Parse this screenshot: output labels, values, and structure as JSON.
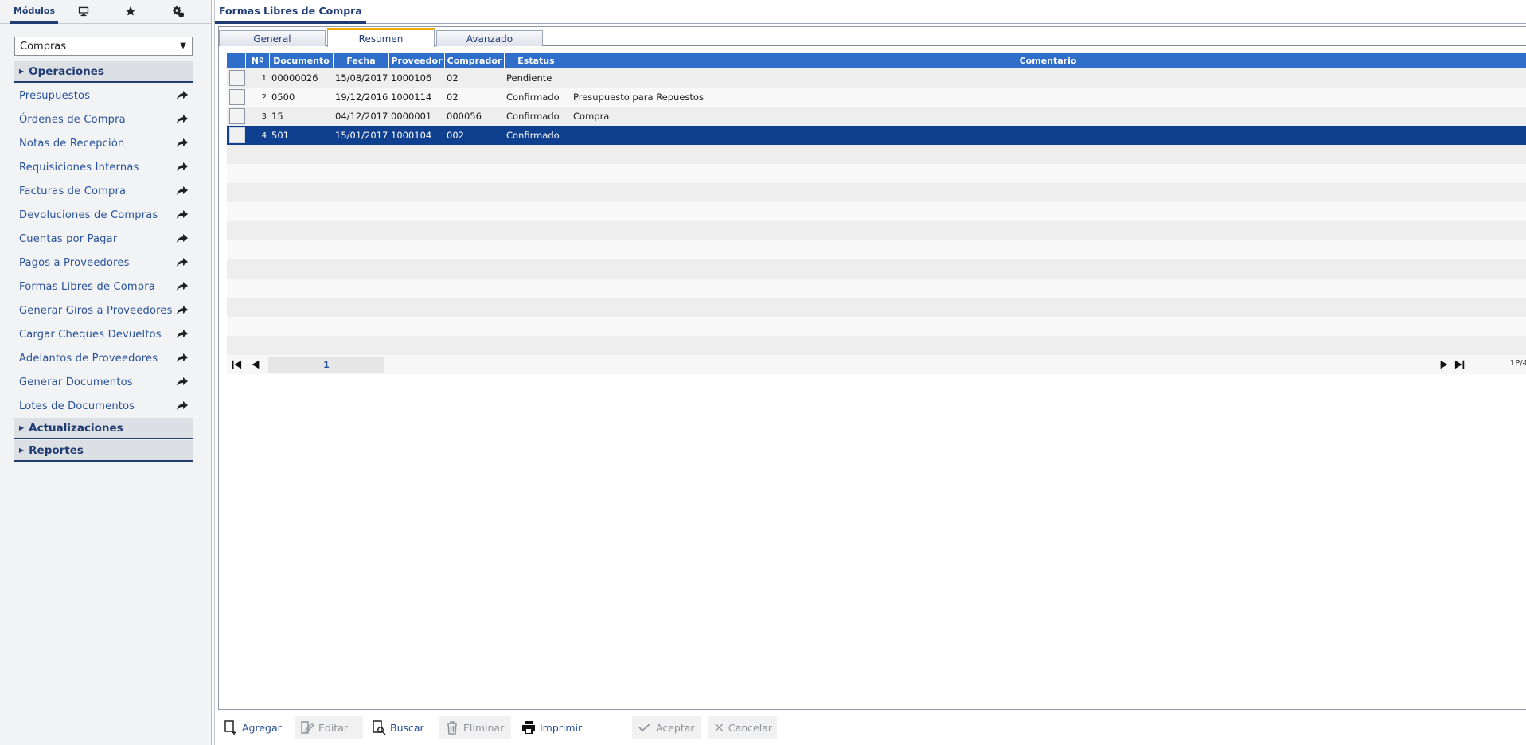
{
  "sidebar": {
    "tabs": {
      "modulos": "Módulos",
      "icons": [
        "monitor-icon",
        "star-icon",
        "settings-icon"
      ]
    },
    "module_select": {
      "value": "Compras"
    },
    "sections": {
      "operaciones": "Operaciones",
      "actualizaciones": "Actualizaciones",
      "reportes": "Reportes"
    },
    "operaciones_items": [
      "Presupuestos",
      "Órdenes de Compra",
      "Notas de Recepción",
      "Requisiciones Internas",
      "Facturas de Compra",
      "Devoluciones de Compras",
      "Cuentas por Pagar",
      "Pagos a Proveedores",
      "Formas Libres de Compra",
      "Generar Giros a Proveedores",
      "Cargar Cheques Devueltos",
      "Adelantos de Proveedores",
      "Generar Documentos",
      "Lotes de Documentos"
    ]
  },
  "main": {
    "title": "Formas Libres de Compra",
    "tabs": [
      "General",
      "Resumen",
      "Avanzado"
    ],
    "active_tab": "Resumen"
  },
  "grid": {
    "columns": [
      "Nº",
      "Documento",
      "Fecha",
      "Proveedor",
      "Comprador",
      "Estatus",
      "Comentario"
    ],
    "rows": [
      {
        "n": "1",
        "documento": "00000026",
        "fecha": "15/08/2017",
        "proveedor": "1000106",
        "comprador": "02",
        "estatus": "Pendiente",
        "comentario": ""
      },
      {
        "n": "2",
        "documento": "0500",
        "fecha": "19/12/2016",
        "proveedor": "1000114",
        "comprador": "02",
        "estatus": "Confirmado",
        "comentario": "Presupuesto para Repuestos"
      },
      {
        "n": "3",
        "documento": "15",
        "fecha": "04/12/2017",
        "proveedor": "0000001",
        "comprador": "000056",
        "estatus": "Confirmado",
        "comentario": "Compra"
      },
      {
        "n": "4",
        "documento": "501",
        "fecha": "15/01/2017",
        "proveedor": "1000104",
        "comprador": "002",
        "estatus": "Confirmado",
        "comentario": ""
      }
    ],
    "selected_row": 4,
    "empty_rows": 11
  },
  "pager": {
    "current_page": "1",
    "info": "1P/4"
  },
  "toolbar": {
    "agregar": "Agregar",
    "editar": "Editar",
    "buscar": "Buscar",
    "eliminar": "Eliminar",
    "imprimir": "Imprimir",
    "aceptar": "Aceptar",
    "cancelar": "Cancelar"
  },
  "colors": {
    "brand": "#1f3d73",
    "header_blue": "#2f6fca",
    "selected_row": "#0f3f8f",
    "tab_accent": "#f2a900"
  }
}
